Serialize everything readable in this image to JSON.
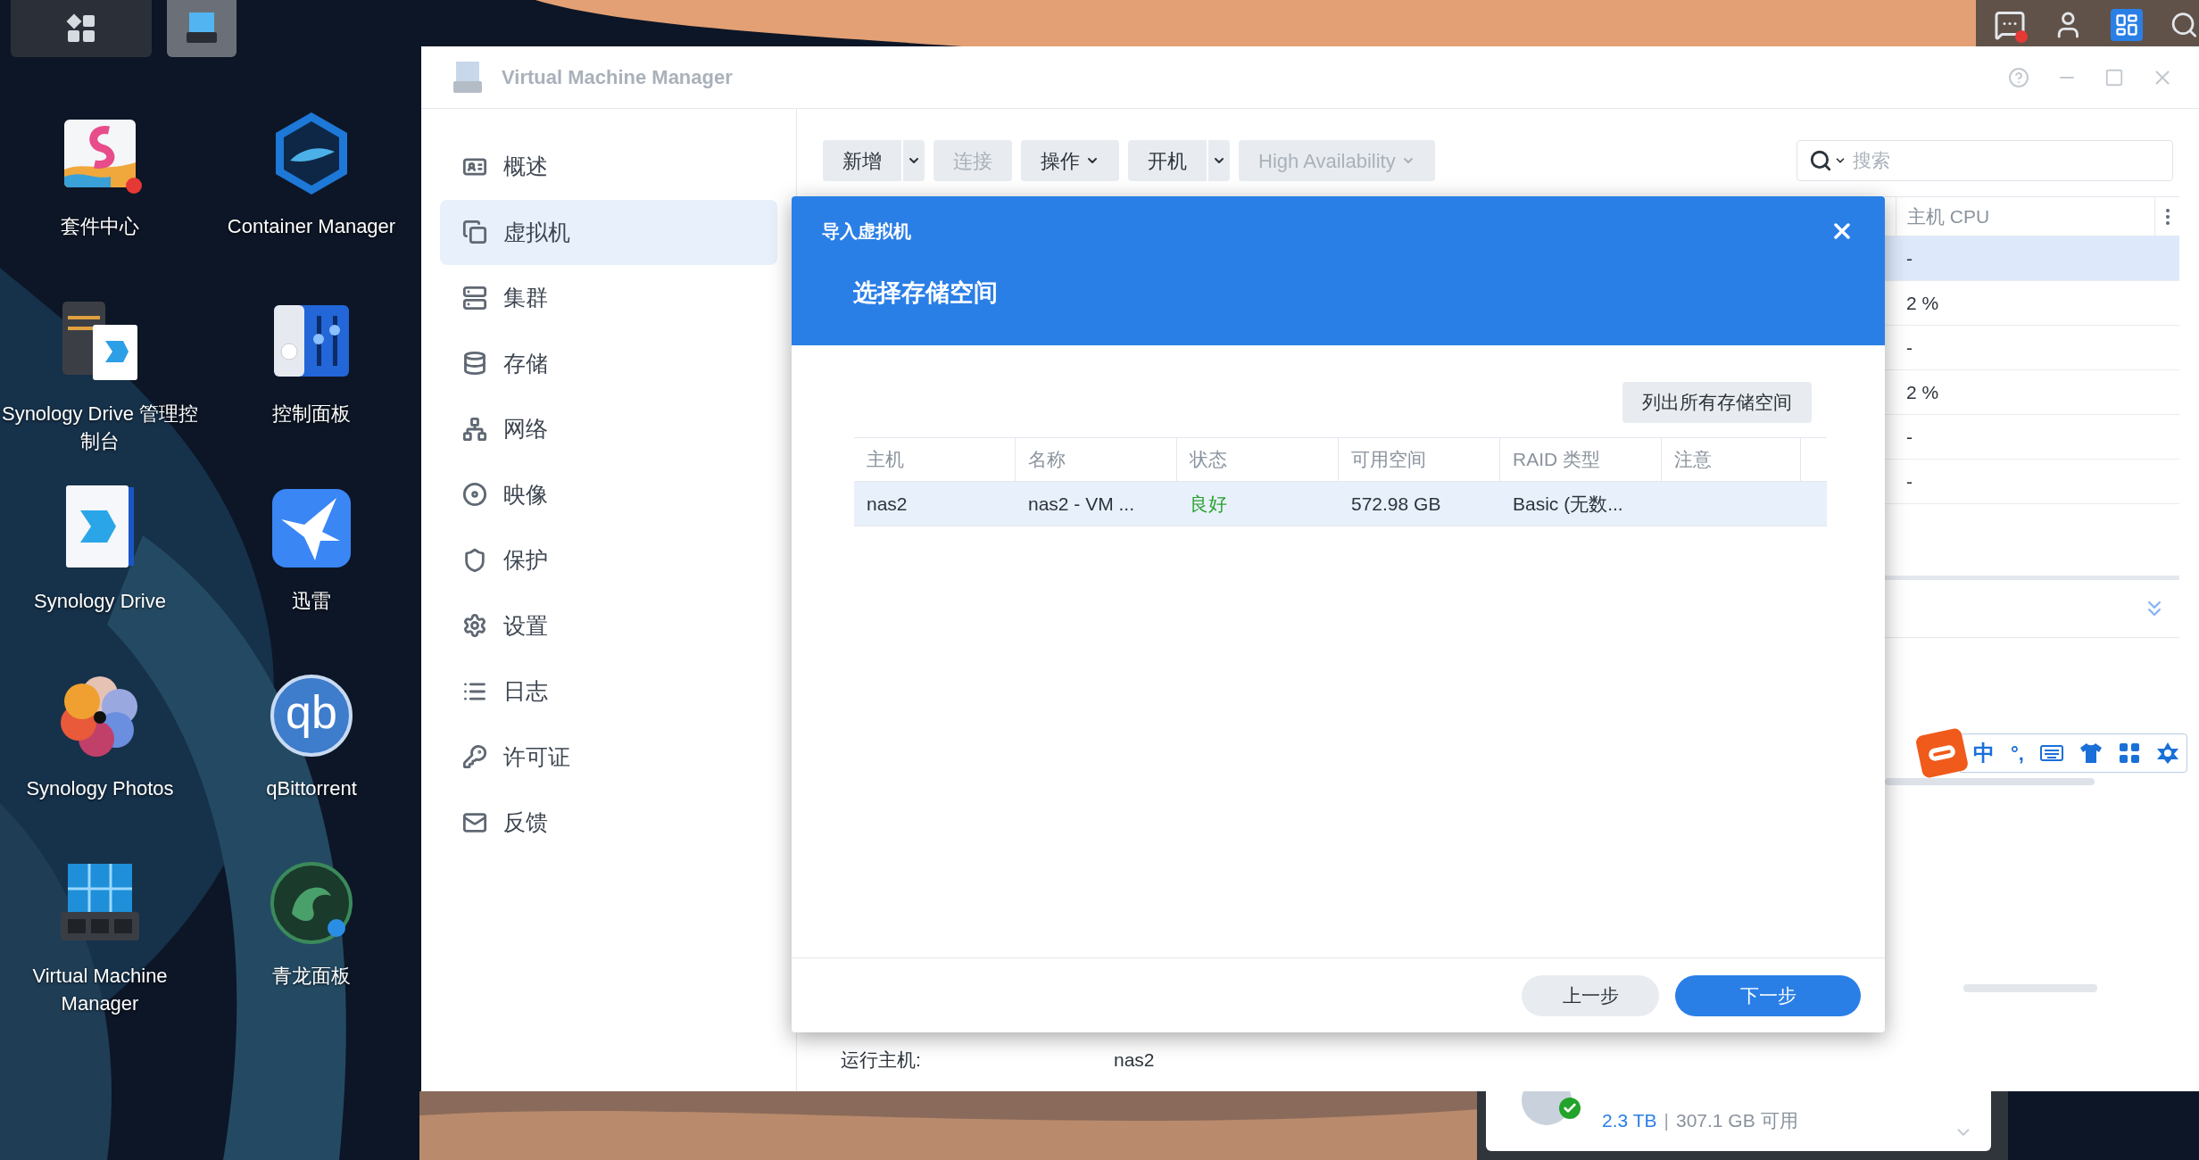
{
  "taskbar": {
    "buttons": [
      {
        "selected": false
      },
      {
        "selected": true
      }
    ]
  },
  "tray": {
    "chat_notification": true
  },
  "desktop_icons": [
    {
      "label": "套件中心"
    },
    {
      "label": "Container Manager"
    },
    {
      "label": "Synology Drive 管理控制台"
    },
    {
      "label": "控制面板"
    },
    {
      "label": "Synology Drive"
    },
    {
      "label": "迅雷"
    },
    {
      "label": "Synology Photos"
    },
    {
      "label": "qBittorrent"
    },
    {
      "label": "Virtual Machine Manager"
    },
    {
      "label": "青龙面板"
    }
  ],
  "desktop_logo_text": "qb",
  "window": {
    "title": "Virtual Machine Manager",
    "sidebar": [
      {
        "label": "概述",
        "selected": false
      },
      {
        "label": "虚拟机",
        "selected": true
      },
      {
        "label": "集群",
        "selected": false
      },
      {
        "label": "存储",
        "selected": false
      },
      {
        "label": "网络",
        "selected": false
      },
      {
        "label": "映像",
        "selected": false
      },
      {
        "label": "保护",
        "selected": false
      },
      {
        "label": "设置",
        "selected": false
      },
      {
        "label": "日志",
        "selected": false
      },
      {
        "label": "许可证",
        "selected": false
      },
      {
        "label": "反馈",
        "selected": false
      }
    ],
    "toolbar": [
      {
        "label": "新增",
        "disabled": false,
        "kind": "split"
      },
      {
        "label": "连接",
        "disabled": true,
        "kind": "plain"
      },
      {
        "label": "操作",
        "disabled": false,
        "kind": "menu"
      },
      {
        "label": "开机",
        "disabled": false,
        "kind": "split"
      },
      {
        "label": "High Availability",
        "disabled": true,
        "kind": "menu"
      }
    ],
    "search": {
      "placeholder": "搜索"
    },
    "table": {
      "column": "主机 CPU",
      "rows": [
        {
          "value": "-",
          "selected": true
        },
        {
          "value": "2 %",
          "selected": false
        },
        {
          "value": "-",
          "selected": false
        },
        {
          "value": "2 %",
          "selected": false
        },
        {
          "value": "-",
          "selected": false
        },
        {
          "value": "-",
          "selected": false
        }
      ]
    },
    "detail": {
      "label": "运行主机:",
      "value": "nas2"
    }
  },
  "ime_bar": {
    "mode": "中",
    "punctuation": "°,"
  },
  "storage_widget": {
    "total": "2.3 TB",
    "separator": "|",
    "free": "307.1 GB 可用"
  },
  "dialog": {
    "title": "导入虚拟机",
    "step": "选择存储空间",
    "list_button": "列出所有存储空间",
    "columns": [
      "主机",
      "名称",
      "状态",
      "可用空间",
      "RAID 类型",
      "注意"
    ],
    "rows": [
      {
        "selected": true,
        "cells": [
          {
            "text": "nas2",
            "kind": "text"
          },
          {
            "text": "nas2 - VM ...",
            "kind": "text"
          },
          {
            "text": "良好",
            "kind": "status"
          },
          {
            "text": "572.98 GB",
            "kind": "text"
          },
          {
            "text": "Basic (无数...",
            "kind": "text"
          }
        ]
      }
    ],
    "buttons": [
      {
        "label": "上一步",
        "kind": "secondary"
      },
      {
        "label": "下一步",
        "kind": "primary"
      }
    ]
  }
}
